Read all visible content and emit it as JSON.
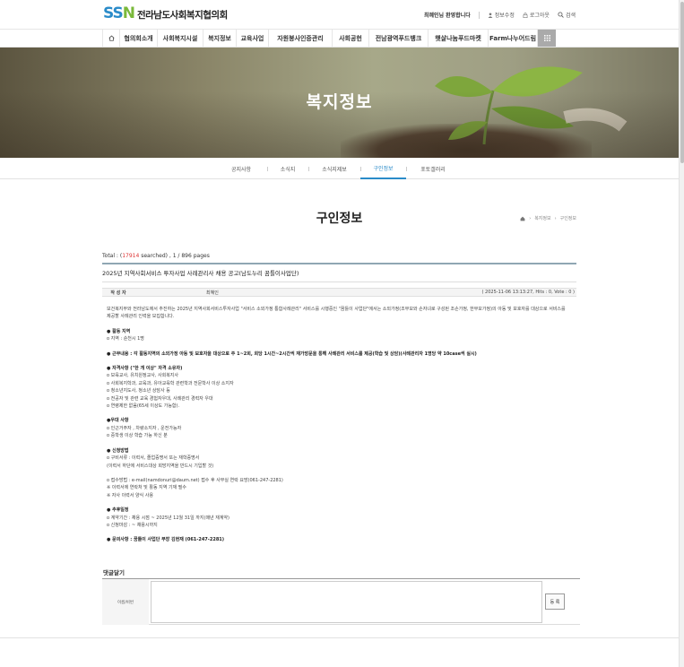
{
  "header": {
    "logo_mark_a": "SS",
    "logo_mark_b": "N",
    "logo_text": "전라남도사회복지협의회",
    "welcome": "최혜인님 환영합니다",
    "util": [
      {
        "label": "정보수정",
        "icon": "person-icon"
      },
      {
        "label": "로그아웃",
        "icon": "lock-icon"
      },
      {
        "label": "검색",
        "icon": "search-icon"
      }
    ]
  },
  "nav": {
    "items": [
      "협의회소개",
      "사회복지시설",
      "복지정보",
      "교육사업",
      "자원봉사인증관리",
      "사회공헌",
      "전남광역푸드뱅크",
      "햇살나눔푸드마켓",
      "Farm나누어드림"
    ]
  },
  "banner": {
    "title": "복지정보"
  },
  "subnav": {
    "items": [
      "공지사항",
      "소식지",
      "소식지제보",
      "구인정보",
      "포토갤러리"
    ],
    "active_index": 3
  },
  "page": {
    "title": "구인정보",
    "breadcrumb": [
      "복지정보",
      "구인정보"
    ]
  },
  "board": {
    "total_prefix": "Total : (",
    "total_count": "17914",
    "total_suffix": " searched) , 1 / 896 pages",
    "post_title": "2025년 지역사회서비스 투자사업 사례관리사 채용 공고(남도누리 꿈틀이사업단)",
    "meta_key": "작 성 자",
    "meta_author": "최혜인",
    "meta_info": "( 2025-11-06 13:13:27, Hits : 0, Vote : 0 )",
    "content": [
      {
        "t": "보건복지부와 전라남도에서 추진하는 2025년 지역사회서비스투자사업 \"서비스 소외가정 통합사례관리\" 서비스를 시행중인 \"꿈틀이 사업단\"에서는 소외가정(조부모와 손자녀로 구성된 조손가정, 한부모가정)의 아동 및 보호자를 대상으로 서비스를",
        "c": ""
      },
      {
        "t": "제공할 사례관리 인력을 모집합니다.",
        "c": ""
      },
      {
        "t": "",
        "c": "gap"
      },
      {
        "t": "● 활동 지역",
        "c": "sec"
      },
      {
        "t": "o 지역 : 순천시 1명",
        "c": ""
      },
      {
        "t": "",
        "c": "gap"
      },
      {
        "t": "● 근무내용 : 각 활동지역의 소외가정 아동 및 보호자을 대상으로 주 1~2회, 회당 1시간~2시간씩 재가방문을 통해 사례관리 서비스를 제공(학습 및 상담)(사례관리자 1명당 약 10case씩 실시)",
        "c": "sec"
      },
      {
        "t": "",
        "c": "gap"
      },
      {
        "t": "● 자격사항 (\"한 개 이상\" 자격 소유자)",
        "c": "sec"
      },
      {
        "t": "o 보육교사, 유치원정교사, 사회복지사",
        "c": ""
      },
      {
        "t": "o 사회복지학과, 교육과, 유아교육학 관련학과 전문학사 이상 소지자",
        "c": ""
      },
      {
        "t": "o 청소년지도사, 청소년 상담사 등",
        "c": ""
      },
      {
        "t": "o 전공자 및 관련 교육 경험자우대, 사례관리 경력자 우대",
        "c": ""
      },
      {
        "t": "o 연령제한 없음(65세 이상도 가능함).",
        "c": ""
      },
      {
        "t": "",
        "c": "gap"
      },
      {
        "t": "●우대 사항",
        "c": "sec"
      },
      {
        "t": "o 인근거주자 , 차량소지자 , 운전가능자",
        "c": ""
      },
      {
        "t": "o 중학생 이상 학습 가능 하신 분",
        "c": ""
      },
      {
        "t": "",
        "c": "gap"
      },
      {
        "t": "● 신청방법",
        "c": "sec"
      },
      {
        "t": "o 구비서류 : 이력서, 졸업증명서 또는 재학증명서",
        "c": ""
      },
      {
        "t": "(이력서 하단에 서비스대상 희망지역을 반드시 기입할 것)",
        "c": ""
      },
      {
        "t": "",
        "c": "gap"
      },
      {
        "t": "o 접수방법 : e-mail(namdonuri@daum.net) 접수 후 사무실 연락 요망(061-247-2281)",
        "c": ""
      },
      {
        "t": "※ 이력서에 연락처 및 활동 지역 기재 필수",
        "c": ""
      },
      {
        "t": "※ 자사 이력서 양식 사용",
        "c": ""
      },
      {
        "t": "",
        "c": "gap"
      },
      {
        "t": "● 추후일정",
        "c": "sec"
      },
      {
        "t": "o 계약기간 : 채용 시점 ~ 2025년 12월 31일 까지(매년 재계약)",
        "c": ""
      },
      {
        "t": "o 신청마감 : ~ 채용시까지",
        "c": ""
      },
      {
        "t": "",
        "c": "gap"
      },
      {
        "t": "● 문의사항 : 꿈틀이 사업단 부장 김현재 (061-247-2281)",
        "c": "sec"
      }
    ]
  },
  "comment": {
    "title": "댓글달기",
    "label": "이름/비번",
    "submit": "등 록"
  }
}
